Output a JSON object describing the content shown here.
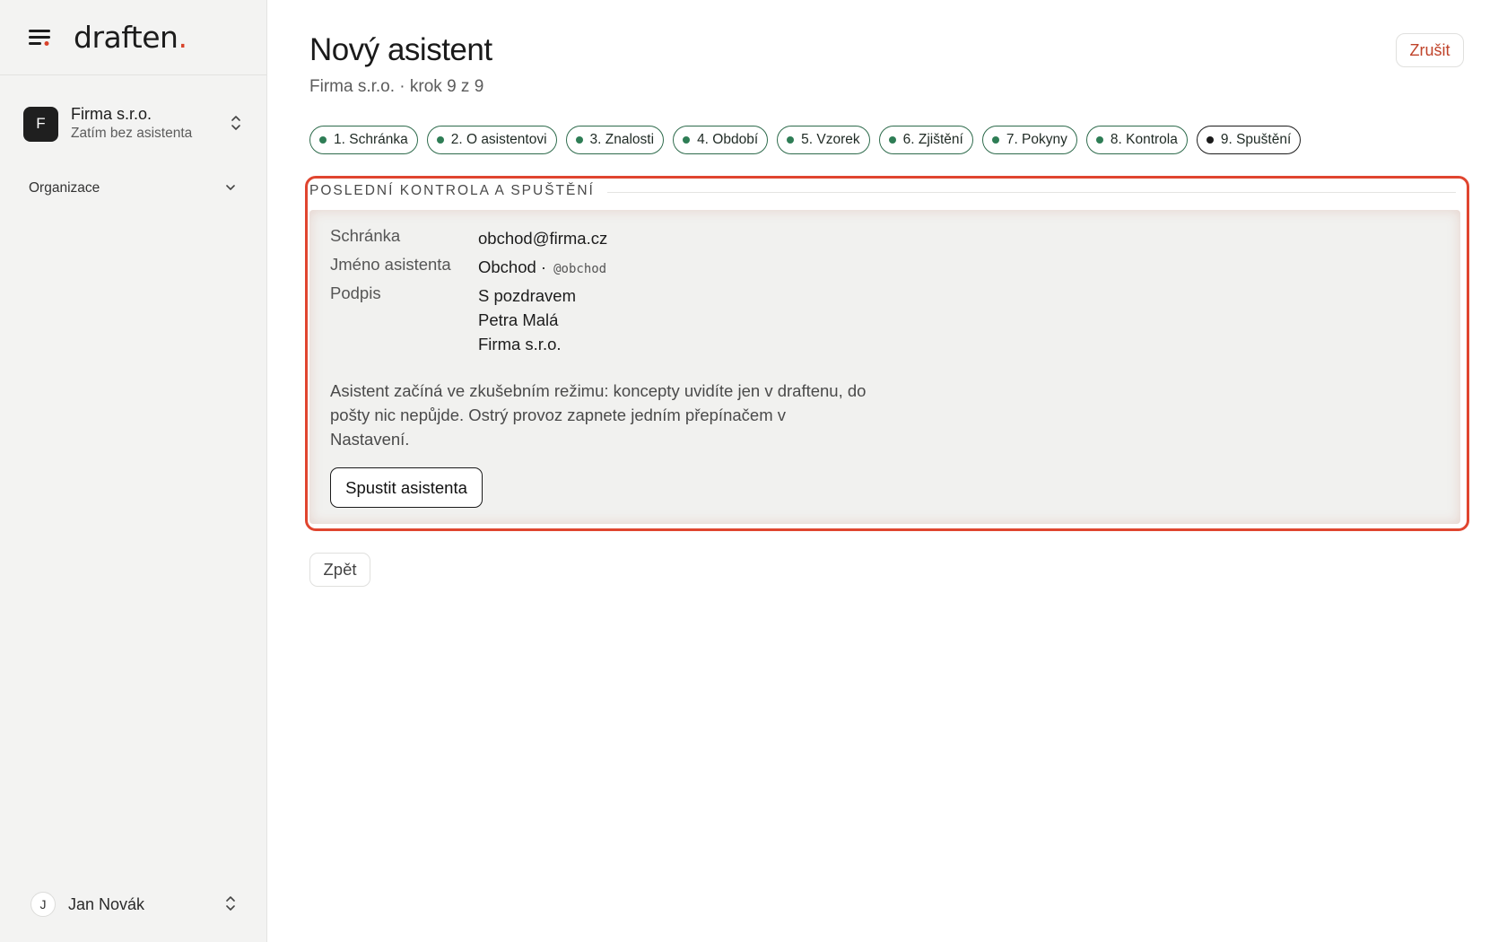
{
  "app": {
    "brand": "draften",
    "brand_dot": "."
  },
  "sidebar": {
    "org": {
      "avatar_letter": "F",
      "name": "Firma s.r.o.",
      "subtitle": "Zatím bez asistenta"
    },
    "section": {
      "label": "Organizace"
    },
    "user": {
      "avatar_letter": "J",
      "name": "Jan Novák"
    }
  },
  "header": {
    "title": "Nový asistent",
    "subtitle": "Firma s.r.o. · krok 9 z 9",
    "cancel_label": "Zrušit"
  },
  "steps": [
    {
      "label": "1. Schránka"
    },
    {
      "label": "2. O asistentovi"
    },
    {
      "label": "3. Znalosti"
    },
    {
      "label": "4. Období"
    },
    {
      "label": "5. Vzorek"
    },
    {
      "label": "6. Zjištění"
    },
    {
      "label": "7. Pokyny"
    },
    {
      "label": "8. Kontrola"
    },
    {
      "label": "9. Spuštění",
      "active": true
    }
  ],
  "review": {
    "section_title": "POSLEDNÍ KONTROLA A SPUŠTĚNÍ",
    "mailbox_label": "Schránka",
    "mailbox_value": "obchod@firma.cz",
    "name_label": "Jméno asistenta",
    "name_value": "Obchod ·",
    "name_handle": "@obchod",
    "signature_label": "Podpis",
    "signature_lines": [
      "S pozdravem",
      "Petra Malá",
      "Firma s.r.o."
    ],
    "info": "Asistent začíná ve zkušebním režimu: koncepty uvidíte jen v draftenu, do pošty nic nepůjde. Ostrý provoz zapnete jedním přepínačem v Nastavení.",
    "launch_label": "Spustit asistenta"
  },
  "footer": {
    "back_label": "Zpět"
  },
  "colors": {
    "accent": "#e0452f",
    "step_green": "#2e7d55",
    "brand_dot": "#d8432b"
  }
}
